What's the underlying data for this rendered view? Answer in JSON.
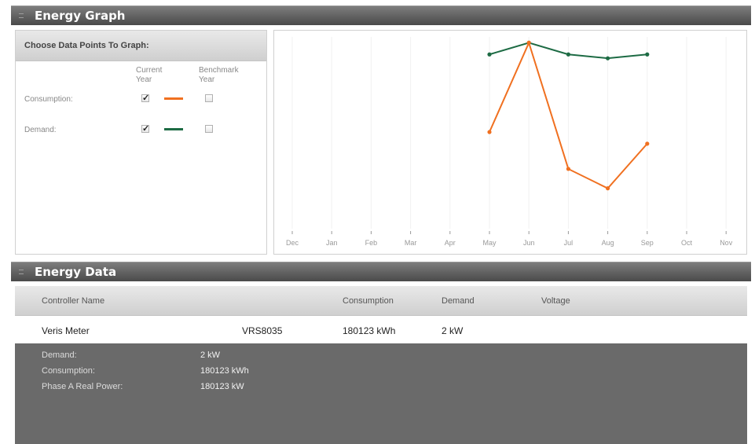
{
  "energy_graph": {
    "title": "Energy Graph",
    "chooser": {
      "title": "Choose Data Points To Graph:",
      "col_current": "Current Year",
      "col_benchmark": "Benchmark Year",
      "rows": [
        {
          "label": "Consumption:",
          "current_checked": true,
          "benchmark_checked": false,
          "color": "#f07020"
        },
        {
          "label": "Demand:",
          "current_checked": true,
          "benchmark_checked": false,
          "color": "#1d6b44"
        }
      ]
    },
    "chart_data": {
      "type": "line",
      "categories": [
        "Dec",
        "Jan",
        "Feb",
        "Mar",
        "Apr",
        "May",
        "Jun",
        "Jul",
        "Aug",
        "Sep",
        "Oct",
        "Nov"
      ],
      "ylim": [
        0,
        100
      ],
      "series": [
        {
          "color": "#1d6b44",
          "values": [
            null,
            null,
            null,
            null,
            null,
            91,
            97,
            91,
            89,
            91,
            null,
            null
          ]
        },
        {
          "color": "#f07020",
          "values": [
            null,
            null,
            null,
            null,
            null,
            51,
            97,
            32,
            22,
            45,
            null,
            null
          ]
        }
      ]
    }
  },
  "energy_data": {
    "title": "Energy Data",
    "columns": [
      "Controller Name",
      "Consumption",
      "Demand",
      "Voltage"
    ],
    "row": {
      "name": "Veris Meter",
      "id": "VRS8035",
      "consumption": "180123 kWh",
      "demand": "2 kW",
      "voltage": ""
    },
    "details": [
      {
        "label": "Demand:",
        "value": "2 kW"
      },
      {
        "label": "Consumption:",
        "value": "180123 kWh"
      },
      {
        "label": "Phase A Real Power:",
        "value": "180123 kW"
      }
    ]
  }
}
